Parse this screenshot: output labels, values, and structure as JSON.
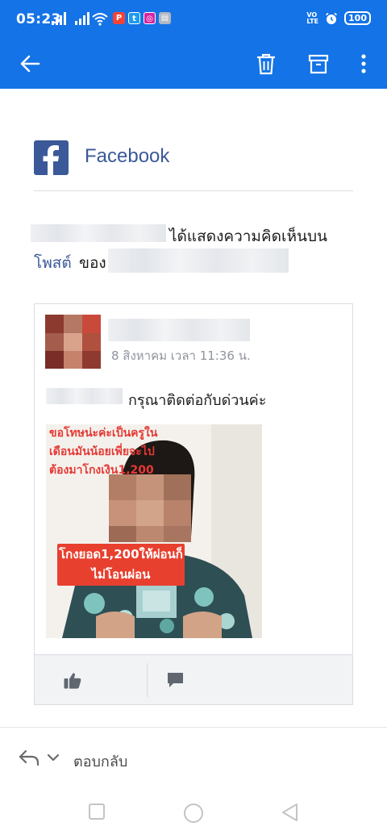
{
  "status_bar": {
    "time": "05:23",
    "volte_line1": "VO",
    "volte_line2": "LTE",
    "battery": "100",
    "icons": [
      "signal-icon",
      "signal-icon",
      "wifi-icon",
      "pdf-notification-icon",
      "twitter-notification-icon",
      "instagram-notification-icon",
      "app-notification-icon",
      "volte-icon",
      "alarm-icon",
      "battery-icon"
    ]
  },
  "app_bar": {
    "icons": [
      "back-arrow-icon",
      "delete-icon",
      "archive-icon",
      "more-options-icon"
    ]
  },
  "email": {
    "brand": "Facebook",
    "notice_line1": "ได้แสดงความคิดเห็นบน",
    "notice_link": "โพสต์",
    "notice_of": "ของ",
    "post": {
      "date": "8 สิงหาคม เวลา 11:36 น.",
      "message": "กรุณาติดต่อกับด่วนค่ะ",
      "image_caption": "ขอโทษน่ะค่ะเป็นครูใน\nเดือนมันน้อยเพี่ยจะไป\nต้องมาโกงเงิน1,200",
      "image_banner": "โกงยอด1,200ให้ผ่อนก็\nไม่โอนผ่อน"
    },
    "actions": {
      "like": "ถูกใจ",
      "comment": "แสดงความคิดเห็น"
    }
  },
  "reply": {
    "label": "ตอบกลับ"
  },
  "colors": {
    "app_bar": "#1473e6",
    "facebook_blue": "#3b5998",
    "action_bg": "#f2f3f5"
  }
}
